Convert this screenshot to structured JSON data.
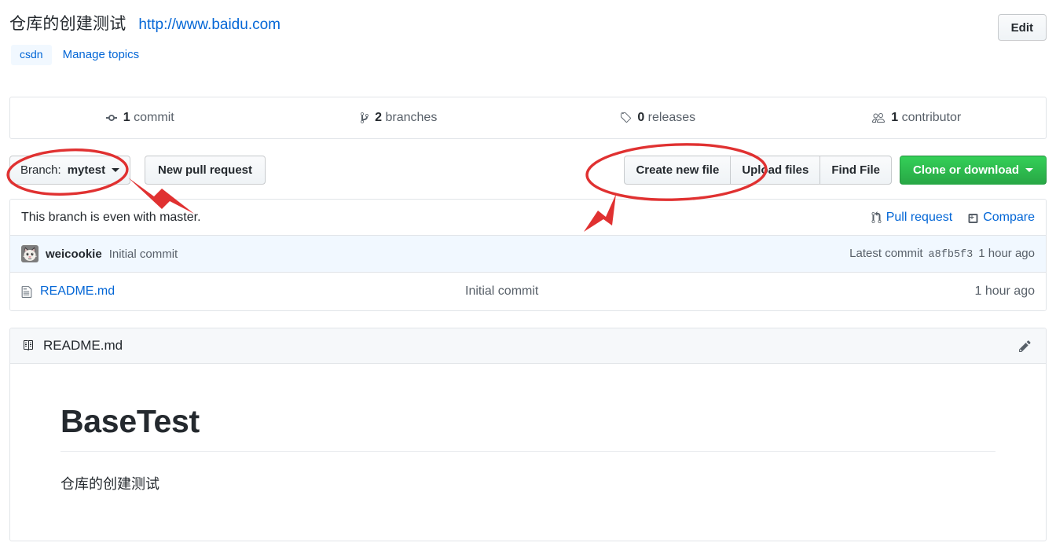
{
  "header": {
    "description": "仓库的创建测试",
    "homepage_url": "http://www.baidu.com",
    "edit_label": "Edit",
    "topic_tag": "csdn",
    "manage_topics_label": "Manage topics"
  },
  "stats": [
    {
      "icon": "commit-icon",
      "count": "1",
      "label": " commit"
    },
    {
      "icon": "branch-icon",
      "count": "2",
      "label": " branches"
    },
    {
      "icon": "tag-icon",
      "count": "0",
      "label": " releases"
    },
    {
      "icon": "people-icon",
      "count": "1",
      "label": " contributor"
    }
  ],
  "toolbar": {
    "branch_prefix": "Branch: ",
    "branch_name": "mytest",
    "new_pull_request_label": "New pull request",
    "create_new_file_label": "Create new file",
    "upload_files_label": "Upload files",
    "find_file_label": "Find File",
    "clone_or_download_label": "Clone or download"
  },
  "branch_status": {
    "text": "This branch is even with master.",
    "pull_request_label": "Pull request",
    "compare_label": "Compare"
  },
  "latest_commit": {
    "author": "weicookie",
    "message": "Initial commit",
    "prefix": "Latest commit",
    "sha": "a8fb5f3",
    "age": "1 hour ago"
  },
  "files": [
    {
      "icon": "file-icon",
      "name": "README.md",
      "message": "Initial commit",
      "age": "1 hour ago"
    }
  ],
  "readme": {
    "title": "README.md",
    "heading": "BaseTest",
    "paragraph": "仓库的创建测试",
    "edit_icon_name": "pencil-icon"
  },
  "annotations": {
    "accent_color": "#e03131",
    "ellipse_branch": "highlights the Branch: mytest selector",
    "ellipse_create_file": "highlights the Create new file button",
    "arrow_branch": "arrow pointing to branch selector",
    "arrow_create_file": "arrow pointing to create new file button"
  }
}
